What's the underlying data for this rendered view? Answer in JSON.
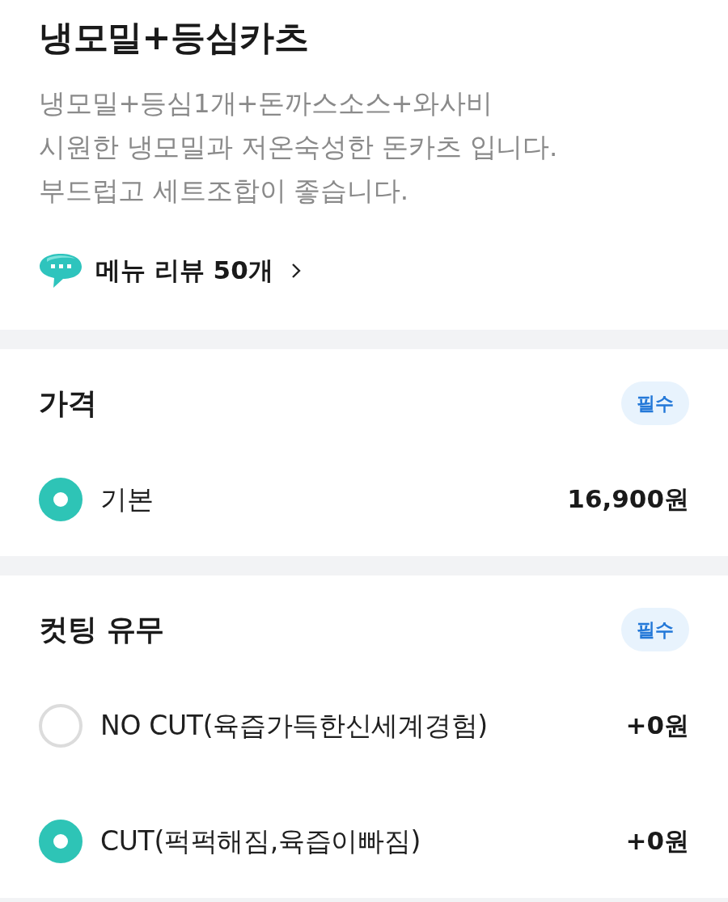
{
  "menu": {
    "title": "냉모밀+등심카츠",
    "description": "냉모밀+등심1개+돈까스소스+와사비\n시원한 냉모밀과 저온숙성한 돈카츠 입니다.\n부드럽고 세트조합이 좋습니다.",
    "review_link": {
      "label": "메뉴 리뷰 50개"
    }
  },
  "option_groups": [
    {
      "title": "가격",
      "badge": "필수",
      "options": [
        {
          "label": "기본",
          "price": "16,900원",
          "selected": true
        }
      ]
    },
    {
      "title": "컷팅 유무",
      "badge": "필수",
      "options": [
        {
          "label": "NO CUT(육즙가득한신세계경험)",
          "price": "+0원",
          "selected": false
        },
        {
          "label": "CUT(퍽퍽해짐,육즙이빠짐)",
          "price": "+0원",
          "selected": true
        }
      ]
    }
  ]
}
